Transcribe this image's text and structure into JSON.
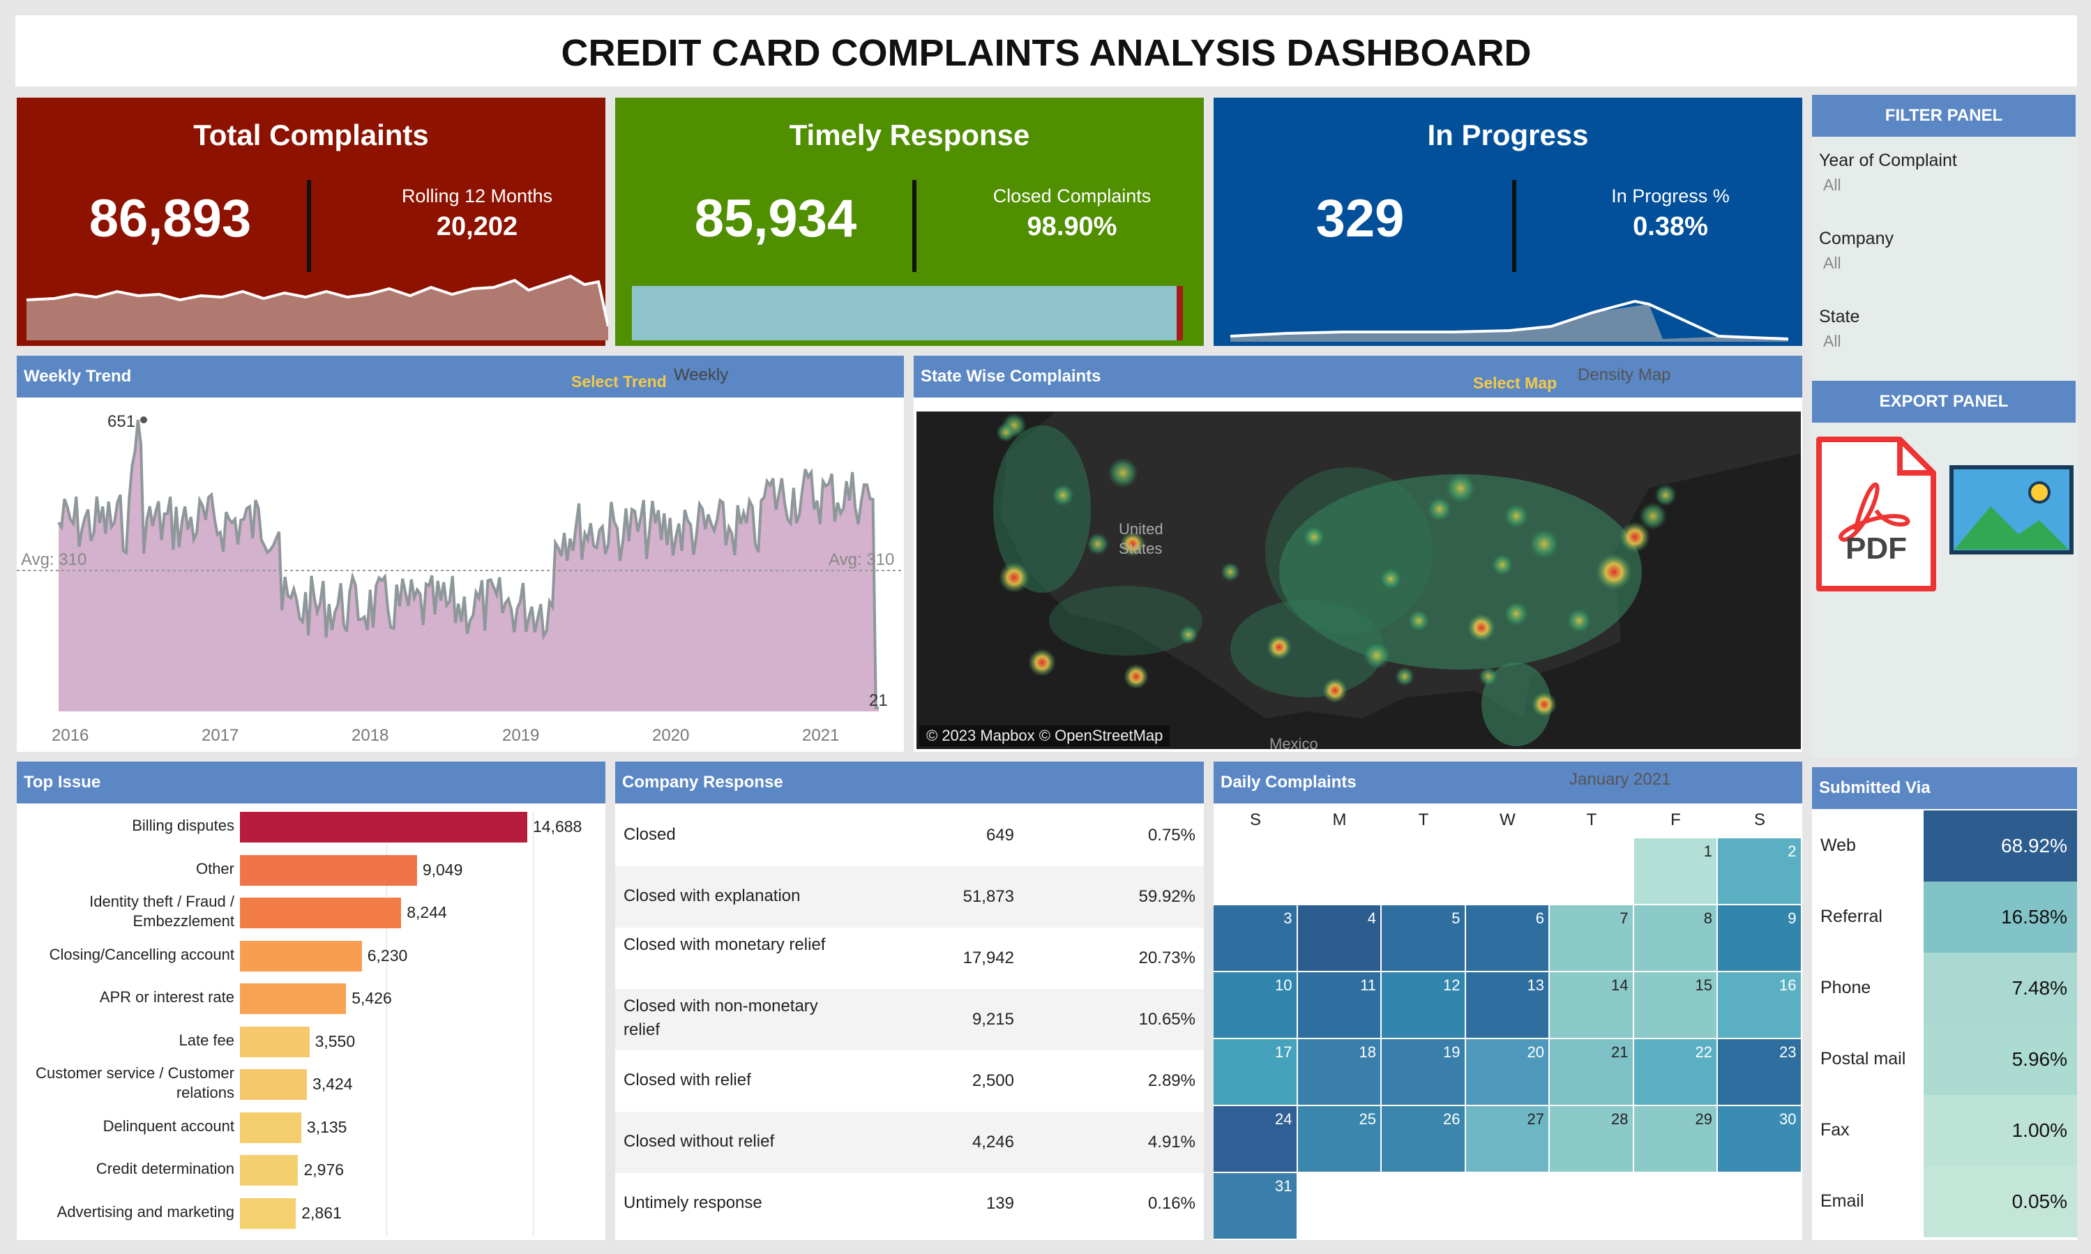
{
  "title": "CREDIT CARD COMPLAINTS ANALYSIS DASHBOARD",
  "colors": {
    "red": "#8e1200",
    "green": "#4f8f00",
    "blue": "#02509a",
    "header": "#5b87c5"
  },
  "kpi_total": {
    "title": "Total Complaints",
    "value": "86,893",
    "sub_label": "Rolling 12 Months",
    "sub_value": "20,202"
  },
  "kpi_timely": {
    "title": "Timely Response",
    "value": "85,934",
    "sub_label": "Closed  Complaints",
    "sub_value": "98.90%",
    "progress": 0.989
  },
  "kpi_progress": {
    "title": "In Progress",
    "value": "329",
    "sub_label": "In Progress %",
    "sub_value": "0.38%"
  },
  "filter_panel": {
    "title": "FILTER PANEL",
    "filters": [
      {
        "label": "Year of Complaint",
        "value": "All"
      },
      {
        "label": "Company",
        "value": "All"
      },
      {
        "label": "State",
        "value": "All"
      }
    ]
  },
  "export_panel": {
    "title": "EXPORT PANEL",
    "pdf_label": "PDF",
    "pdf_icon": "pdf-icon",
    "image_icon": "image-icon"
  },
  "weekly": {
    "title": "Weekly Trend",
    "select_label": "Select Trend",
    "select_value": "Weekly",
    "max_label": "651",
    "min_label": "21",
    "avg_left": "Avg: 310",
    "avg_right": "Avg: 310",
    "years": [
      "2016",
      "2017",
      "2018",
      "2019",
      "2020",
      "2021"
    ]
  },
  "map": {
    "title": "State Wise Complaints",
    "select_label": "Select Map",
    "select_value": "Density Map",
    "attribution": "© 2023 Mapbox © OpenStreetMap",
    "label_us_1": "United",
    "label_us_2": "States",
    "label_mx": "Mexico"
  },
  "top_issue": {
    "title": "Top Issue",
    "items": [
      {
        "label": "Billing disputes",
        "value": "14,688",
        "n": 14688,
        "color": "#b71c3c"
      },
      {
        "label": "Other",
        "value": "9,049",
        "n": 9049,
        "color": "#ef7549"
      },
      {
        "label": "Identity theft / Fraud / Embezzlement",
        "value": "8,244",
        "n": 8244,
        "color": "#f27c45"
      },
      {
        "label": "Closing/Cancelling account",
        "value": "6,230",
        "n": 6230,
        "color": "#f79e50"
      },
      {
        "label": "APR or interest rate",
        "value": "5,426",
        "n": 5426,
        "color": "#f8a354"
      },
      {
        "label": "Late fee",
        "value": "3,550",
        "n": 3550,
        "color": "#f4c86b"
      },
      {
        "label": "Customer service / Customer relations",
        "value": "3,424",
        "n": 3424,
        "color": "#f4c86b"
      },
      {
        "label": "Delinquent account",
        "value": "3,135",
        "n": 3135,
        "color": "#f4cd6c"
      },
      {
        "label": "Credit determination",
        "value": "2,976",
        "n": 2976,
        "color": "#f4cf6e"
      },
      {
        "label": "Advertising and marketing",
        "value": "2,861",
        "n": 2861,
        "color": "#f4d06f"
      }
    ]
  },
  "company_response": {
    "title": "Company Response",
    "rows": [
      {
        "name": "Closed",
        "count": "649",
        "pct": "0.75%"
      },
      {
        "name": "Closed with explanation",
        "count": "51,873",
        "pct": "59.92%"
      },
      {
        "name": "Closed with monetary relief",
        "count": "17,942",
        "pct": "20.73%"
      },
      {
        "name": "Closed with non-monetary relief",
        "count": "9,215",
        "pct": "10.65%"
      },
      {
        "name": "Closed with relief",
        "count": "2,500",
        "pct": "2.89%"
      },
      {
        "name": "Closed without relief",
        "count": "4,246",
        "pct": "4.91%"
      },
      {
        "name": "Untimely response",
        "count": "139",
        "pct": "0.16%"
      }
    ]
  },
  "daily": {
    "title": "Daily Complaints",
    "month": "January 2021",
    "weekdays": [
      "S",
      "M",
      "T",
      "W",
      "T",
      "F",
      "S"
    ],
    "days": [
      "1",
      "2",
      "3",
      "4",
      "5",
      "6",
      "7",
      "8",
      "9",
      "10",
      "11",
      "12",
      "13",
      "14",
      "15",
      "16",
      "17",
      "18",
      "19",
      "20",
      "21",
      "22",
      "23",
      "24",
      "25",
      "26",
      "27",
      "28",
      "29",
      "30",
      "31"
    ],
    "colors": [
      "#b3e0d6",
      "#5ab0c2",
      "#2f6fa0",
      "#2d5c8f",
      "#2f6fa0",
      "#2f6fa0",
      "#8cc9c9",
      "#8cc9c9",
      "#3286ad",
      "#3286ad",
      "#2f6fa0",
      "#3286ad",
      "#2f6fa0",
      "#8cc9c9",
      "#8cc9c9",
      "#5ab0c2",
      "#46a1bd",
      "#3a7fac",
      "#3a7fac",
      "#4f99bd",
      "#7ec2c7",
      "#5ab0c2",
      "#2f6fa0",
      "#2f5f94",
      "#3a86ad",
      "#3a86ad",
      "#6fb7c4",
      "#8cc9c9",
      "#8cc9c9",
      "#3a8cb5",
      "#3a7fac"
    ]
  },
  "submitted_via": {
    "title": "Submitted Via",
    "rows": [
      {
        "name": "Web",
        "pct": "68.92%",
        "color": "#2d5c8f",
        "text": "#fff"
      },
      {
        "name": "Referral",
        "pct": "16.58%",
        "color": "#82c3c8",
        "text": "#111"
      },
      {
        "name": "Phone",
        "pct": "7.48%",
        "color": "#a9d9d0",
        "text": "#111"
      },
      {
        "name": "Postal mail",
        "pct": "5.96%",
        "color": "#acdbd1",
        "text": "#111"
      },
      {
        "name": "Fax",
        "pct": "1.00%",
        "color": "#bde3d6",
        "text": "#111"
      },
      {
        "name": "Email",
        "pct": "0.05%",
        "color": "#c4e6d8",
        "text": "#111"
      }
    ]
  }
}
